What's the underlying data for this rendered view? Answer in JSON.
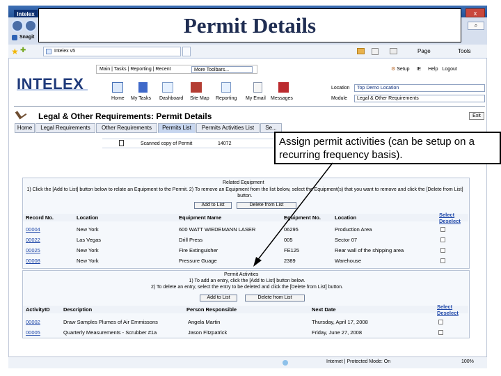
{
  "slide_title": "Permit Details",
  "callout": "Assign permit activities (can be setup on a recurring frequency basis).",
  "browser": {
    "left_tab": "Intelex",
    "snagit": "Snagit",
    "tab": "Intelex v5",
    "window_close": "x",
    "page_menu": "Page",
    "tools_menu": "Tools",
    "zoom": "100%",
    "status": "Internet | Protected Mode: On"
  },
  "app": {
    "logo": "INTELEX",
    "menu": "Main | Tasks | Reporting | Recent",
    "toolbars": "More Toolbars...",
    "setup": "Setup",
    "ie": "IE",
    "help": "Help",
    "logout": "Logout",
    "icons": [
      "Home",
      "My Tasks",
      "Dashboard",
      "Site Map",
      "Reporting",
      "My Email",
      "Messages"
    ],
    "location_label": "Location",
    "location_value": "Top Demo Location",
    "module_label": "Module",
    "module_value": "Legal & Other Requirements",
    "page_heading": "Legal & Other Requirements:  Permit Details",
    "exit": "Exit",
    "tabs": [
      "Home",
      "Legal Requirements",
      "Other Requirements",
      "Permits List",
      "Permits Activities List",
      "Se..."
    ],
    "doc_row": {
      "name": "Scanned copy of Permit",
      "id": "14072"
    }
  },
  "equipment": {
    "title": "Related Equipment",
    "instructions": "1) Click the [Add to List] button below to relate an Equipment to the Permit. 2) To remove an Equipment from the list below, select the Equipment(s) that you want to remove and click the [Delete from List] button.",
    "add_button": "Add to List",
    "delete_button": "Delete from List",
    "select": "Select",
    "deselect": "Deselect",
    "columns": [
      "Record No.",
      "Location",
      "Equipment Name",
      "Equipment No.",
      "Location"
    ],
    "rows": [
      [
        "00004",
        "New York",
        "600 WATT WIEDEMANN LASER",
        "06295",
        "Production Area"
      ],
      [
        "00022",
        "Las Vegas",
        "Drill Press",
        "005",
        "Sector 07"
      ],
      [
        "00025",
        "New York",
        "Fire Extinguisher",
        "FE125",
        "Rear wall of the shipping area"
      ],
      [
        "00008",
        "New York",
        "Pressure Guage",
        "2389",
        "Warehouse"
      ]
    ]
  },
  "activities": {
    "title": "Permit Activities",
    "line1": "1) To add an entry, click the [Add to List] button below.",
    "line2": "2) To delete an entry, select the entry to be deleted and click the [Delete from List] button.",
    "add_button": "Add to List",
    "delete_button": "Delete from List",
    "select": "Select",
    "deselect": "Deselect",
    "columns": [
      "ActivityID",
      "Description",
      "Person Responsible",
      "Next Date"
    ],
    "rows": [
      [
        "00002",
        "Draw Samples Plumes of Air Emmissons",
        "Angela Martin",
        "Thursday, April 17, 2008"
      ],
      [
        "00005",
        "Quarterly Measurements - Scrubber #1a",
        "Jason Fitzpatrick",
        "Friday, June 27, 2008"
      ]
    ]
  }
}
